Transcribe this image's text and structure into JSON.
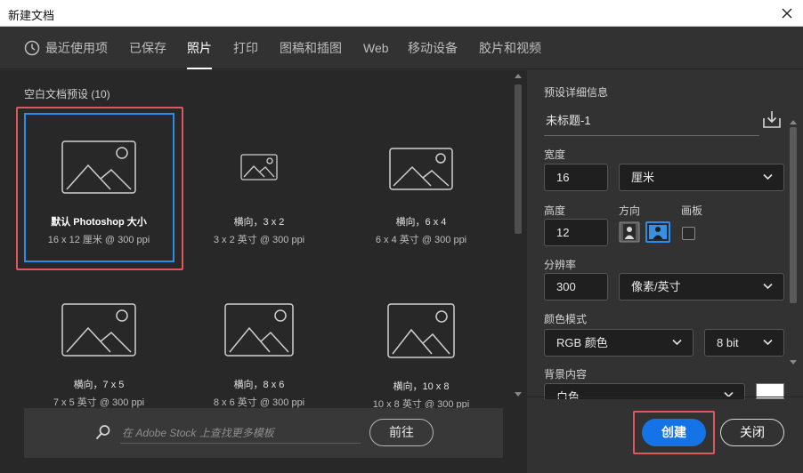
{
  "window": {
    "title": "新建文档"
  },
  "tabs": [
    {
      "label": "最近使用项",
      "active": false,
      "icon": "clock-icon"
    },
    {
      "label": "已保存",
      "active": false
    },
    {
      "label": "照片",
      "active": true
    },
    {
      "label": "打印",
      "active": false
    },
    {
      "label": "图稿和插图",
      "active": false
    },
    {
      "label": "Web",
      "active": false
    },
    {
      "label": "移动设备",
      "active": false
    },
    {
      "label": "胶片和视频",
      "active": false
    }
  ],
  "presets": {
    "section_title": "空白文档预设 (10)",
    "items": [
      {
        "name": "默认 Photoshop 大小",
        "spec": "16 x 12 厘米 @ 300 ppi",
        "selected": true
      },
      {
        "name": "横向，3 x 2",
        "spec": "3 x 2 英寸 @ 300 ppi",
        "selected": false
      },
      {
        "name": "横向，6 x 4",
        "spec": "6 x 4 英寸 @ 300 ppi",
        "selected": false
      },
      {
        "name": "横向，7 x 5",
        "spec": "7 x 5 英寸 @ 300 ppi",
        "selected": false
      },
      {
        "name": "横向，8 x 6",
        "spec": "8 x 6 英寸 @ 300 ppi",
        "selected": false
      },
      {
        "name": "横向，10 x 8",
        "spec": "10 x 8 英寸 @ 300 ppi",
        "selected": false
      }
    ]
  },
  "stock": {
    "placeholder": "在 Adobe Stock 上查找更多模板",
    "go_label": "前往"
  },
  "details": {
    "title": "预设详细信息",
    "doc_name": "未标题-1",
    "width_label": "宽度",
    "width_value": "16",
    "unit": "厘米",
    "height_label": "高度",
    "height_value": "12",
    "orientation_label": "方向",
    "artboard_label": "画板",
    "resolution_label": "分辨率",
    "resolution_value": "300",
    "resolution_unit": "像素/英寸",
    "color_mode_label": "颜色模式",
    "color_mode": "RGB 颜色",
    "bit_depth": "8 bit",
    "background_label": "背景内容",
    "background": "白色",
    "background_color": "#ffffff"
  },
  "footer": {
    "create_label": "创建",
    "close_label": "关闭"
  },
  "colors": {
    "accent": "#1473e6",
    "selection": "#2d8ceb",
    "highlight": "#e0585d"
  }
}
